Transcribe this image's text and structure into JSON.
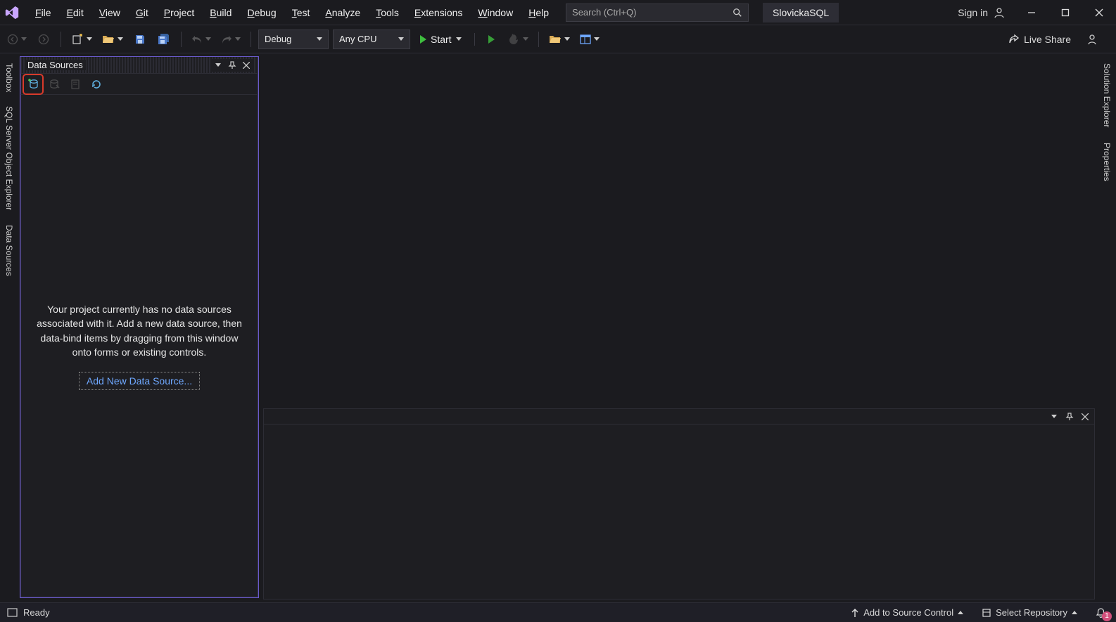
{
  "menubar": {
    "items": [
      {
        "u": "F",
        "rest": "ile"
      },
      {
        "u": "E",
        "rest": "dit"
      },
      {
        "u": "V",
        "rest": "iew"
      },
      {
        "u": "G",
        "rest": "it"
      },
      {
        "u": "P",
        "rest": "roject"
      },
      {
        "u": "B",
        "rest": "uild"
      },
      {
        "u": "D",
        "rest": "ebug"
      },
      {
        "u": "T",
        "rest": "est"
      },
      {
        "u": "A",
        "rest": "nalyze"
      },
      {
        "u": "T",
        "rest": "ools"
      },
      {
        "u": "E",
        "rest": "xtensions"
      },
      {
        "u": "W",
        "rest": "indow"
      },
      {
        "u": "H",
        "rest": "elp"
      }
    ]
  },
  "search_placeholder": "Search (Ctrl+Q)",
  "project_name": "SlovickaSQL",
  "sign_in": "Sign in",
  "toolbar": {
    "config": "Debug",
    "platform": "Any CPU",
    "start": "Start",
    "live_share": "Live Share"
  },
  "left_tabs": [
    "Toolbox",
    "SQL Server Object Explorer",
    "Data Sources"
  ],
  "right_tabs": [
    "Solution Explorer",
    "Properties"
  ],
  "panel": {
    "title": "Data Sources",
    "empty_msg": "Your project currently has no data sources associated with it. Add a new data source, then data-bind items by dragging from this window onto forms or existing controls.",
    "add_link": "Add New Data Source..."
  },
  "status": {
    "ready": "Ready",
    "add_source_control": "Add to Source Control",
    "select_repo": "Select Repository",
    "notification_count": "1"
  }
}
